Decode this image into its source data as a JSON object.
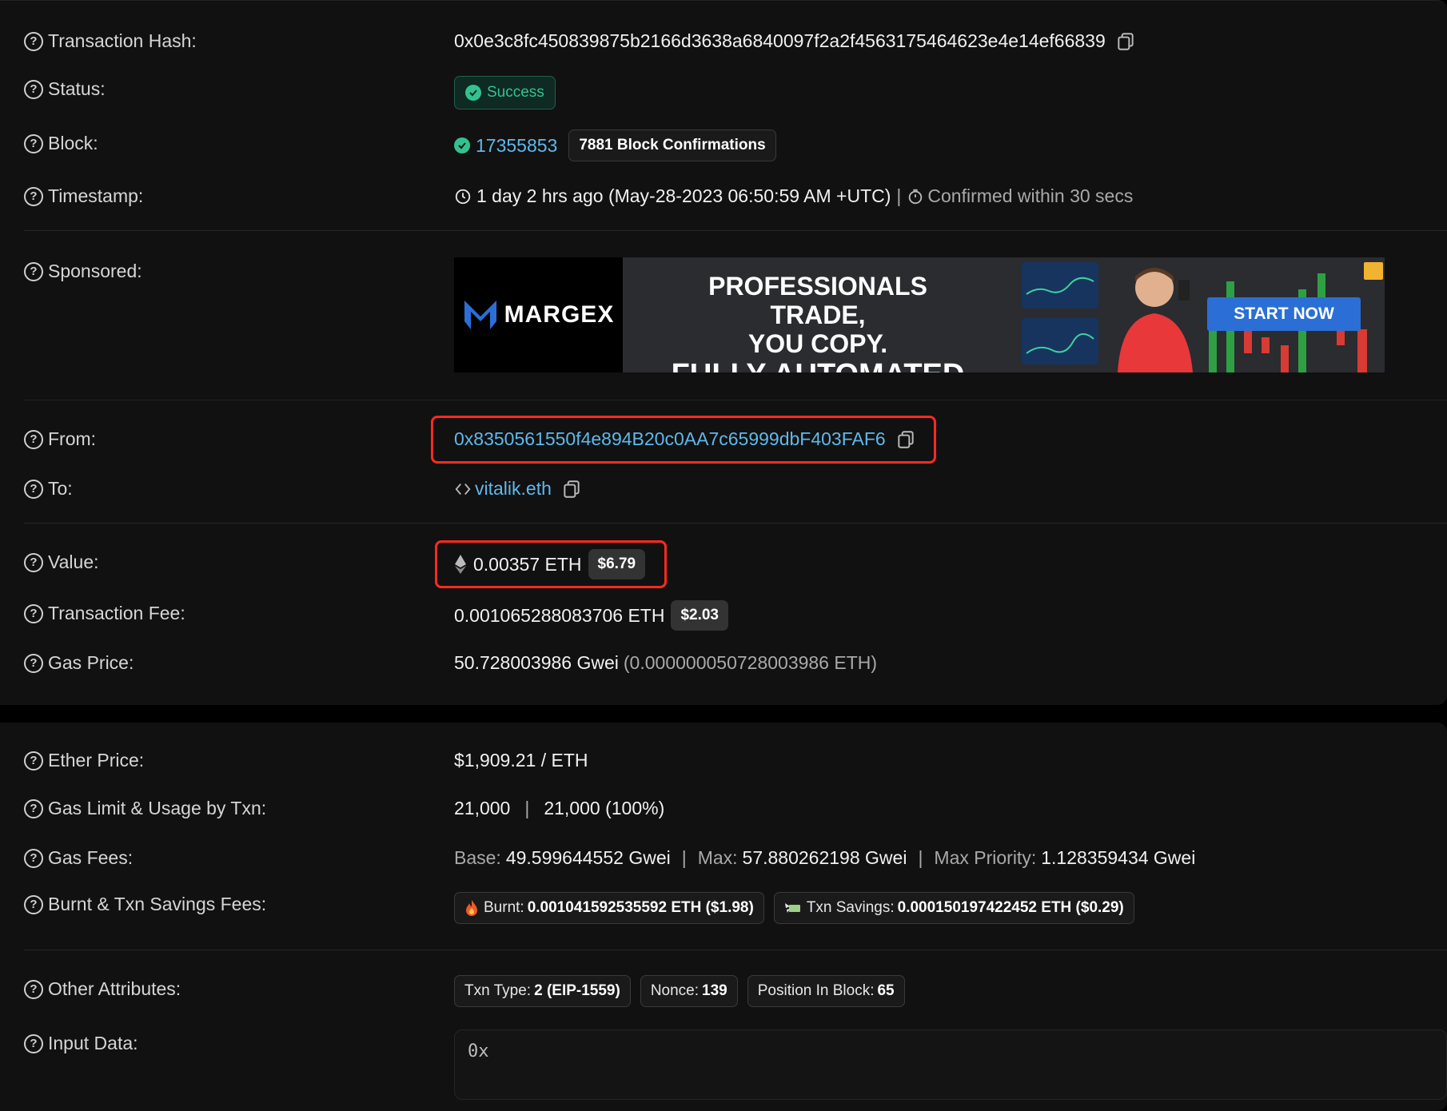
{
  "labels": {
    "tx_hash": "Transaction Hash:",
    "status": "Status:",
    "block": "Block:",
    "timestamp": "Timestamp:",
    "sponsored": "Sponsored:",
    "from": "From:",
    "to": "To:",
    "value": "Value:",
    "tx_fee": "Transaction Fee:",
    "gas_price": "Gas Price:",
    "ether_price": "Ether Price:",
    "gas_limit": "Gas Limit & Usage by Txn:",
    "gas_fees": "Gas Fees:",
    "burnt": "Burnt & Txn Savings Fees:",
    "other": "Other Attributes:",
    "input": "Input Data:"
  },
  "help_icon": "?",
  "tx_hash": "0x0e3c8fc450839875b2166d3638a6840097f2a2f4563175464623e4e14ef66839",
  "status": "Success",
  "block": {
    "number": "17355853",
    "confirmations": "7881 Block Confirmations"
  },
  "timestamp": {
    "relative": "1 day 2 hrs ago (May-28-2023 06:50:59 AM +UTC)",
    "separator": "|",
    "confirmed": "Confirmed within 30 secs"
  },
  "ad": {
    "brand": "MARGEX",
    "line1": "PROFESSIONALS TRADE,",
    "line2": "YOU COPY.",
    "line3": "FULLY AUTOMATED",
    "cta": "START NOW"
  },
  "from": "0x8350561550f4e894B20c0AA7c65999dbF403FAF6",
  "to": "vitalik.eth",
  "value": {
    "eth": "0.00357 ETH",
    "usd": "$6.79"
  },
  "tx_fee": {
    "eth": "0.001065288083706 ETH",
    "usd": "$2.03"
  },
  "gas_price": {
    "gwei": "50.728003986 Gwei",
    "eth": "(0.000000050728003986 ETH)"
  },
  "ether_price": "$1,909.21 / ETH",
  "gas_limit": {
    "limit": "21,000",
    "sep": "|",
    "usage": "21,000 (100%)"
  },
  "gas_fees": {
    "base_label": "Base:",
    "base": "49.599644552 Gwei",
    "max_label": "Max:",
    "max": "57.880262198 Gwei",
    "priority_label": "Max Priority:",
    "priority": "1.128359434 Gwei",
    "sep": "|"
  },
  "burnt": {
    "burnt_label": "Burnt:",
    "burnt_value": "0.001041592535592 ETH ($1.98)",
    "savings_label": "Txn Savings:",
    "savings_value": "0.000150197422452 ETH ($0.29)"
  },
  "attributes": {
    "type_label": "Txn Type:",
    "type_value": "2 (EIP-1559)",
    "nonce_label": "Nonce:",
    "nonce_value": "139",
    "position_label": "Position In Block:",
    "position_value": "65"
  },
  "input_data": "0x",
  "colors": {
    "link": "#5fb8ec",
    "success": "#33c28f",
    "highlight": "#ff2a1f"
  }
}
